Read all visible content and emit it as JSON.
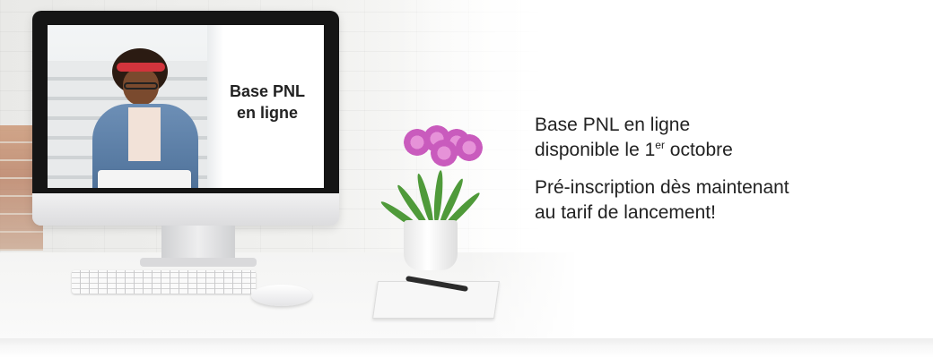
{
  "screen": {
    "title_line1": "Base PNL",
    "title_line2": "en ligne"
  },
  "copy": {
    "line1": "Base PNL en ligne",
    "line2_prefix": "disponible le 1",
    "line2_sup": "er",
    "line2_suffix": " octobre",
    "line3": "Pré-inscription dès maintenant",
    "line4": "au tarif de lancement!"
  }
}
